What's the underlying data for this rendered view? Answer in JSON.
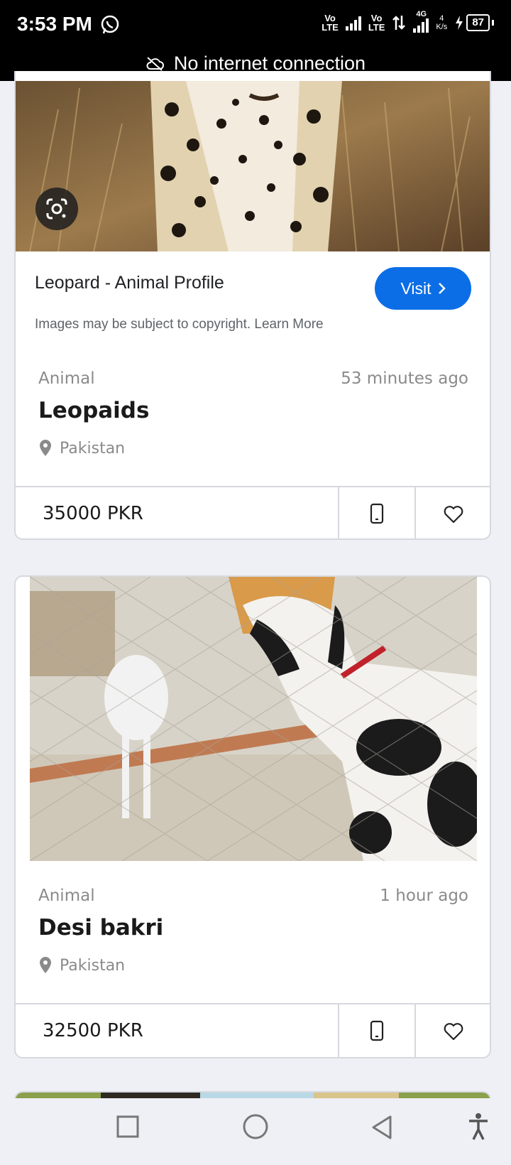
{
  "status_bar": {
    "time": "3:53 PM",
    "net1": "Vo\nLTE",
    "net2": "Vo\nLTE",
    "gen": "4G",
    "speed_value": "4",
    "speed_unit": "K/s",
    "battery": "87",
    "banner": "No internet connection"
  },
  "cards": [
    {
      "lens_label": "Leopard - Animal Profile",
      "visit_label": "Visit",
      "copyright_note": "Images may be subject to copyright. Learn More",
      "category": "Animal",
      "time": "53 minutes ago",
      "title": "Leopaids",
      "location": "Pakistan",
      "price": "35000 PKR"
    },
    {
      "category": "Animal",
      "time": "1 hour ago",
      "title": "Desi bakri",
      "location": "Pakistan",
      "price": "32500 PKR"
    }
  ],
  "icons": {
    "whatsapp": "whatsapp-icon",
    "cloud_off": "cloud-off-icon",
    "lens": "google-lens-icon",
    "chevron": "chevron-right-icon",
    "location": "location-pin-icon",
    "phone": "phone-icon",
    "heart": "heart-icon",
    "nav_recent": "square-icon",
    "nav_home": "circle-icon",
    "nav_back": "triangle-back-icon",
    "accessibility": "accessibility-icon"
  },
  "colors": {
    "accent": "#0b6ee6",
    "background": "#eff0f5",
    "card_border": "#d7d8de"
  }
}
